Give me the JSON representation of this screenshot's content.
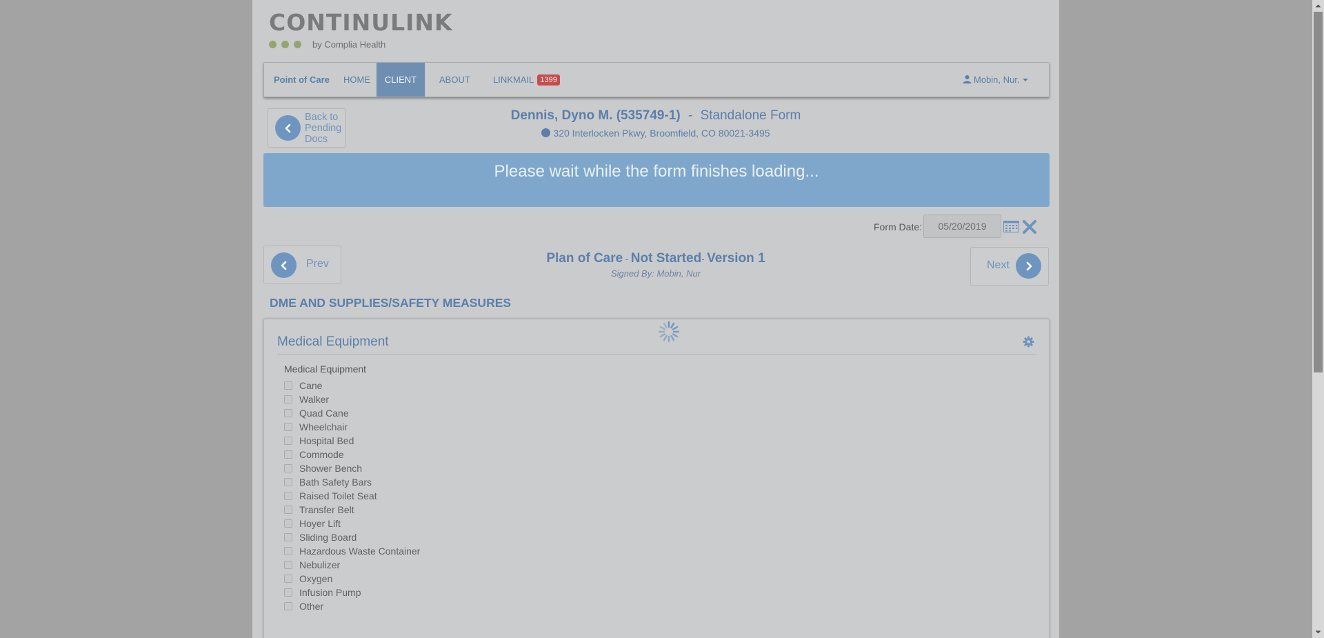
{
  "logo": {
    "word": "CONTINULINK",
    "tagline": "by Complia Health"
  },
  "nav": {
    "brand": "Point of Care",
    "items": [
      {
        "label": "HOME"
      },
      {
        "label": "CLIENT"
      },
      {
        "label": "ABOUT"
      },
      {
        "label": "LINKMAIL",
        "badge": "1399"
      }
    ],
    "user": "Mobin, Nur."
  },
  "back_button": {
    "line1": "Back to",
    "line2": "Pending",
    "line3": "Docs"
  },
  "client": {
    "name": "Dennis, Dyno M. (535749-1)",
    "separator": "-",
    "form_kind": "Standalone Form",
    "address": "320 Interlocken Pkwy, Broomfield, CO 80021-3495"
  },
  "banner": {
    "message": "Please wait while the form finishes loading..."
  },
  "form_date": {
    "label": "Form Date:",
    "value": "05/20/2019"
  },
  "pager": {
    "prev": "Prev",
    "next": "Next"
  },
  "form": {
    "name": "Plan of Care",
    "sep1": " - ",
    "status": "Not Started",
    "sep2": "- ",
    "version": "Version 1",
    "signed_by": "Signed By: Mobin, Nur"
  },
  "section": {
    "heading": "DME AND SUPPLIES/SAFETY MEASURES",
    "panel_title": "Medical Equipment",
    "field_label": "Medical Equipment",
    "options": [
      "Cane",
      "Walker",
      "Quad Cane",
      "Wheelchair",
      "Hospital Bed",
      "Commode",
      "Shower Bench",
      "Bath Safety Bars",
      "Raised Toilet Seat",
      "Transfer Belt",
      "Hoyer Lift",
      "Sliding Board",
      "Hazardous Waste Container",
      "Nebulizer",
      "Oxygen",
      "Infusion Pump",
      "Other"
    ]
  },
  "colors": {
    "accent": "#5b7faa",
    "banner": "#7ea7cb",
    "badge": "#c44e4e",
    "logo_dots": "#95a571"
  },
  "icons": [
    "user-icon",
    "globe-icon",
    "chevron-left-icon",
    "chevron-right-icon",
    "calendar-icon",
    "close-icon",
    "gear-icon",
    "spinner-icon"
  ]
}
